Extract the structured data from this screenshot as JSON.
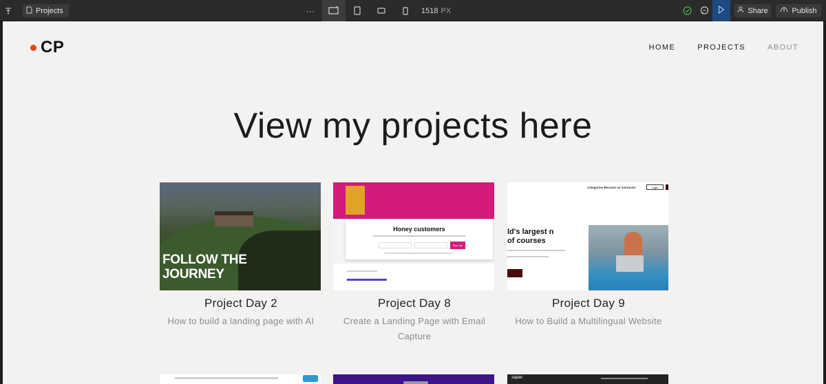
{
  "toolbar": {
    "pages_label": "Projects",
    "breakpoint_width": "1518",
    "breakpoint_unit": "PX",
    "more_glyph": "···",
    "share_label": "Share",
    "publish_label": "Publish",
    "icons": [
      "pin-icon",
      "page-icon",
      "desktop-breakpoint-icon",
      "tablet-breakpoint-icon",
      "mobile-landscape-icon",
      "mobile-portrait-icon",
      "check-circle-icon",
      "comment-icon",
      "play-icon",
      "user-icon",
      "publish-icon"
    ],
    "colors": {
      "bar": "#2b2b2b",
      "preview": "#1f4a80",
      "check": "#3fb950"
    }
  },
  "site": {
    "logo_text": "CP",
    "logo_dot_color": "#e5461b",
    "nav": [
      {
        "label": "HOME"
      },
      {
        "label": "PROJECTS"
      },
      {
        "label": "ABOUT"
      }
    ],
    "heading": "View my projects here",
    "projects": [
      {
        "title": "Project Day 2",
        "description": "How to build a landing page with AI",
        "thumb_text": "FOLLOW THE JOURNEY"
      },
      {
        "title": "Project Day 8",
        "description": "Create a Landing Page with Email Capture",
        "thumb_text": "Honey customers",
        "thumb_button": "Sign up!"
      },
      {
        "title": "Project Day 9",
        "description": "How to Build a Multilingual Website",
        "thumb_text": "ld's largest n of courses",
        "thumb_nav": "Categories   Become an instructor",
        "thumb_button": "Login"
      }
    ],
    "partial_cards": [
      {
        "thumb_text": ""
      },
      {
        "thumb_text": ""
      },
      {
        "thumb_text": "zapier"
      }
    ]
  }
}
